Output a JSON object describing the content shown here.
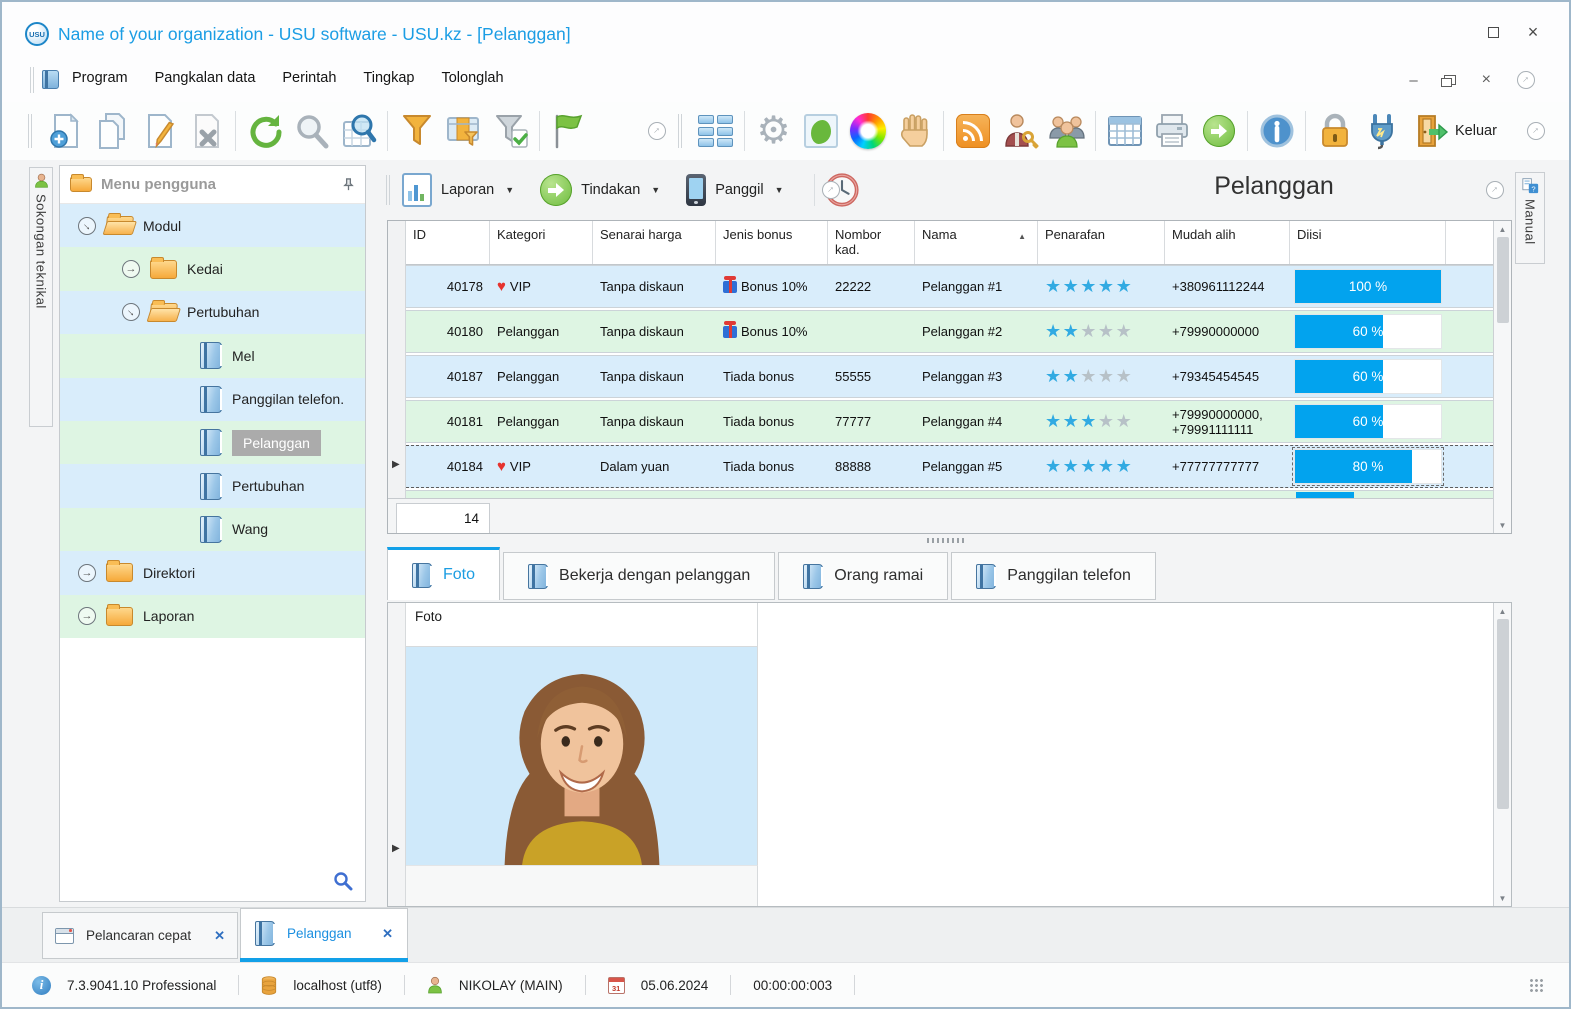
{
  "window": {
    "title": "Name of your organization - USU software - USU.kz - [Pelanggan]",
    "logo_text": "USU"
  },
  "menubar": {
    "items": [
      "Program",
      "Pangkalan data",
      "Perintah",
      "Tingkap",
      "Tolonglah"
    ]
  },
  "toolbar": {
    "exit_label": "Keluar"
  },
  "side_tabs": {
    "left_label": "Sokongan teknikal",
    "right_label": "Manual"
  },
  "tree": {
    "header": "Menu pengguna",
    "items": [
      {
        "label": "Modul",
        "icon": "folder-open",
        "level": 0,
        "expander": "expanded"
      },
      {
        "label": "Kedai",
        "icon": "folder",
        "level": 1,
        "expander": "collapsed"
      },
      {
        "label": "Pertubuhan",
        "icon": "folder-open",
        "level": 1,
        "expander": "expanded"
      },
      {
        "label": "Mel",
        "icon": "book",
        "level": 2
      },
      {
        "label": "Panggilan telefon.",
        "icon": "book",
        "level": 2
      },
      {
        "label": "Pelanggan",
        "icon": "book",
        "level": 2,
        "selected": true
      },
      {
        "label": "Pertubuhan",
        "icon": "book",
        "level": 2
      },
      {
        "label": "Wang",
        "icon": "book",
        "level": 2
      },
      {
        "label": "Direktori",
        "icon": "folder",
        "level": 0,
        "expander": "collapsed"
      },
      {
        "label": "Laporan",
        "icon": "folder",
        "level": 0,
        "expander": "collapsed"
      }
    ]
  },
  "panel": {
    "title": "Pelanggan",
    "menu_buttons": [
      {
        "label": "Laporan"
      },
      {
        "label": "Tindakan"
      },
      {
        "label": "Panggil"
      }
    ]
  },
  "table": {
    "columns": [
      "ID",
      "Kategori",
      "Senarai harga",
      "Jenis bonus",
      "Nombor kad.",
      "Nama",
      "Penarafan",
      "Mudah alih",
      "Diisi"
    ],
    "sort_column": "Nama",
    "rows": [
      {
        "id": "40178",
        "heart": true,
        "category": "VIP",
        "price_list": "Tanpa diskaun",
        "gift": true,
        "bonus": "Bonus 10%",
        "card": "22222",
        "name": "Pelanggan #1",
        "rating": 5,
        "mobile": [
          "+380961112244"
        ],
        "filled_pct": 100,
        "filled_label": "100 %"
      },
      {
        "id": "40180",
        "heart": false,
        "category": "Pelanggan",
        "price_list": "Tanpa diskaun",
        "gift": true,
        "bonus": "Bonus 10%",
        "card": "",
        "name": "Pelanggan #2",
        "rating": 2,
        "mobile": [
          "+79990000000"
        ],
        "filled_pct": 60,
        "filled_label": "60 %"
      },
      {
        "id": "40187",
        "heart": false,
        "category": "Pelanggan",
        "price_list": "Tanpa diskaun",
        "gift": false,
        "bonus": "Tiada bonus",
        "card": "55555",
        "name": "Pelanggan #3",
        "rating": 2,
        "mobile": [
          "+79345454545"
        ],
        "filled_pct": 60,
        "filled_label": "60 %"
      },
      {
        "id": "40181",
        "heart": false,
        "category": "Pelanggan",
        "price_list": "Tanpa diskaun",
        "gift": false,
        "bonus": "Tiada bonus",
        "card": "77777",
        "name": "Pelanggan #4",
        "rating": 3,
        "mobile": [
          "+79990000000,",
          "+79991111111"
        ],
        "filled_pct": 60,
        "filled_label": "60 %"
      },
      {
        "id": "40184",
        "heart": true,
        "category": "VIP",
        "price_list": "Dalam yuan",
        "gift": false,
        "bonus": "Tiada bonus",
        "card": "88888",
        "name": "Pelanggan #5",
        "rating": 5,
        "mobile": [
          "+77777777777"
        ],
        "filled_pct": 80,
        "filled_label": "80 %",
        "selected": true
      }
    ],
    "summary_count": "14"
  },
  "detail_tabs": [
    {
      "label": "Foto",
      "active": true
    },
    {
      "label": "Bekerja dengan pelanggan",
      "active": false
    },
    {
      "label": "Orang ramai",
      "active": false
    },
    {
      "label": "Panggilan telefon",
      "active": false
    }
  ],
  "photo_panel": {
    "column_header": "Foto"
  },
  "bottom_tabs": [
    {
      "label": "Pelancaran cepat",
      "active": false
    },
    {
      "label": "Pelanggan",
      "active": true
    }
  ],
  "statusbar": {
    "version": "7.3.9041.10 Professional",
    "database": "localhost (utf8)",
    "user": "NIKOLAY (MAIN)",
    "calendar_day": "31",
    "date": "05.06.2024",
    "timer": "00:00:00:003"
  },
  "ui": {
    "star": "★",
    "heart": "♥",
    "row_marker": "▶",
    "sort_asc": "▲",
    "caret_down": "▼",
    "close_x": "✕",
    "minimize_dash": "–",
    "mdi_close": "×",
    "expander_arrow": "→",
    "scroll_up": "▲",
    "scroll_down": "▼"
  }
}
